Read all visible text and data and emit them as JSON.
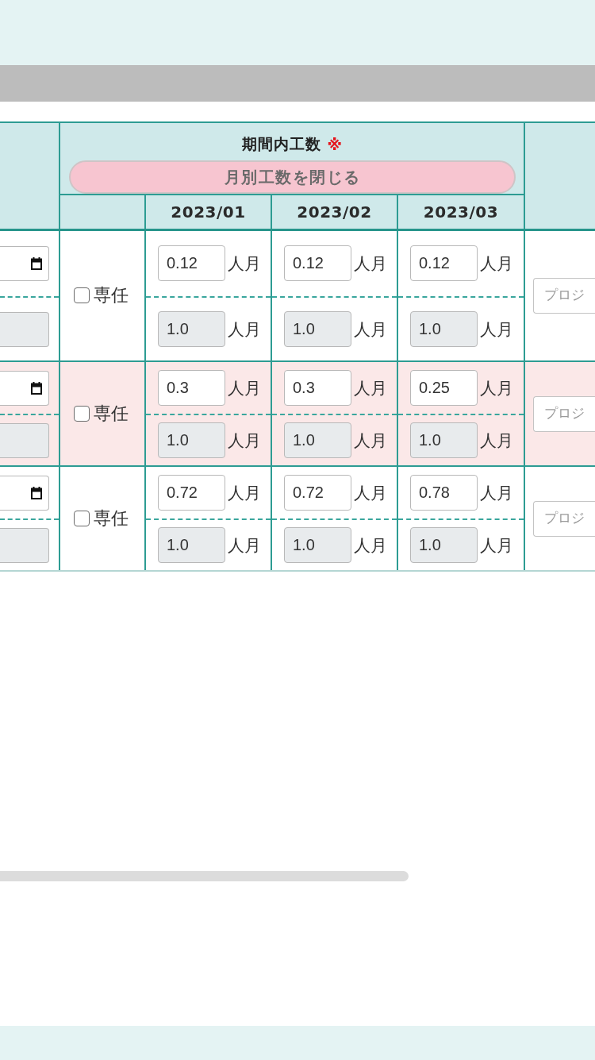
{
  "period_header": {
    "title": "期間内工数",
    "required_mark": "※",
    "toggle_button": "月別工数を閉じる",
    "months": [
      "2023/01",
      "2023/02",
      "2023/03"
    ]
  },
  "rows": [
    {
      "highlighted": false,
      "column_1": [
        {
          "kind": "date",
          "disabled": false
        },
        {
          "kind": "text",
          "disabled": true
        }
      ],
      "full_time": {
        "label": "専任",
        "checked": false
      },
      "months": [
        {
          "upper": {
            "value": "0.12",
            "unit": "人月",
            "disabled": false
          },
          "lower": {
            "value": "1.0",
            "unit": "人月",
            "disabled": true
          }
        },
        {
          "upper": {
            "value": "0.12",
            "unit": "人月",
            "disabled": false
          },
          "lower": {
            "value": "1.0",
            "unit": "人月",
            "disabled": true
          }
        },
        {
          "upper": {
            "value": "0.12",
            "unit": "人月",
            "disabled": false
          },
          "lower": {
            "value": "1.0",
            "unit": "人月",
            "disabled": true
          }
        }
      ],
      "project": {
        "placeholder": "プロジ"
      }
    },
    {
      "highlighted": true,
      "column_1": [
        {
          "kind": "date",
          "disabled": false
        },
        {
          "kind": "text",
          "disabled": true
        }
      ],
      "full_time": {
        "label": "専任",
        "checked": false
      },
      "months": [
        {
          "upper": {
            "value": "0.3",
            "unit": "人月",
            "disabled": false
          },
          "lower": {
            "value": "1.0",
            "unit": "人月",
            "disabled": true
          }
        },
        {
          "upper": {
            "value": "0.3",
            "unit": "人月",
            "disabled": false
          },
          "lower": {
            "value": "1.0",
            "unit": "人月",
            "disabled": true
          }
        },
        {
          "upper": {
            "value": "0.25",
            "unit": "人月",
            "disabled": false
          },
          "lower": {
            "value": "1.0",
            "unit": "人月",
            "disabled": true
          }
        }
      ],
      "project": {
        "placeholder": "プロジ"
      }
    },
    {
      "highlighted": false,
      "column_1": [
        {
          "kind": "date",
          "disabled": false
        },
        {
          "kind": "text",
          "disabled": true
        }
      ],
      "full_time": {
        "label": "専任",
        "checked": false
      },
      "months": [
        {
          "upper": {
            "value": "0.72",
            "unit": "人月",
            "disabled": false
          },
          "lower": {
            "value": "1.0",
            "unit": "人月",
            "disabled": true
          }
        },
        {
          "upper": {
            "value": "0.72",
            "unit": "人月",
            "disabled": false
          },
          "lower": {
            "value": "1.0",
            "unit": "人月",
            "disabled": true
          }
        },
        {
          "upper": {
            "value": "0.78",
            "unit": "人月",
            "disabled": false
          },
          "lower": {
            "value": "1.0",
            "unit": "人月",
            "disabled": true
          }
        }
      ],
      "project": {
        "placeholder": "プロジ"
      }
    }
  ]
}
